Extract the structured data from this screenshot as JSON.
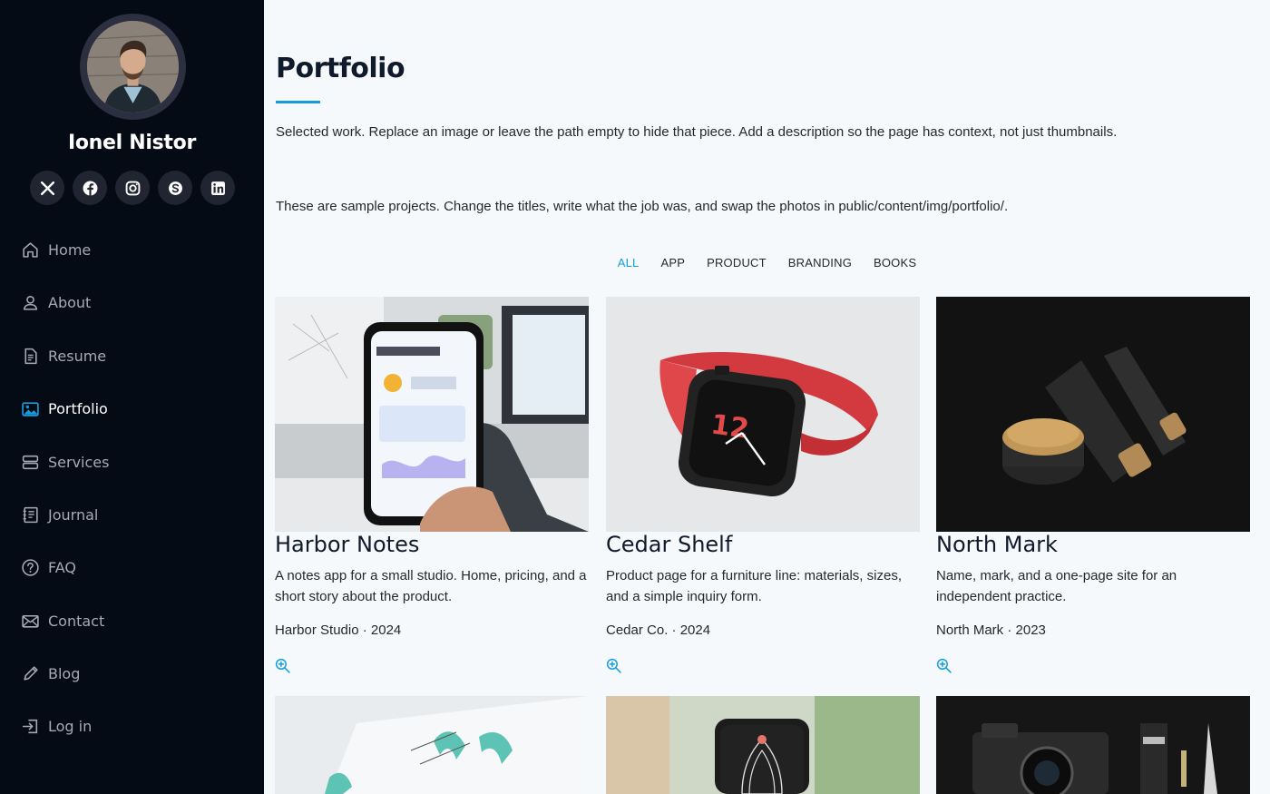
{
  "profile": {
    "name": "Ionel Nistor"
  },
  "social": [
    {
      "icon": "x-twitter-icon",
      "label": "X"
    },
    {
      "icon": "facebook-icon",
      "label": "Facebook"
    },
    {
      "icon": "instagram-icon",
      "label": "Instagram"
    },
    {
      "icon": "skype-icon",
      "label": "Skype"
    },
    {
      "icon": "linkedin-icon",
      "label": "LinkedIn"
    }
  ],
  "nav": [
    {
      "label": "Home",
      "icon": "house-icon"
    },
    {
      "label": "About",
      "icon": "person-icon"
    },
    {
      "label": "Resume",
      "icon": "file-text-icon"
    },
    {
      "label": "Portfolio",
      "icon": "images-icon",
      "active": true
    },
    {
      "label": "Services",
      "icon": "server-icon"
    },
    {
      "label": "Journal",
      "icon": "journal-icon"
    },
    {
      "label": "FAQ",
      "icon": "question-circle-icon"
    },
    {
      "label": "Contact",
      "icon": "envelope-icon"
    },
    {
      "label": "Blog",
      "icon": "pencil-icon"
    },
    {
      "label": "Log in",
      "icon": "box-arrow-in-icon"
    }
  ],
  "portfolio": {
    "title": "Portfolio",
    "intro": "Selected work. Replace an image or leave the path empty to hide that piece. Add a description so the page has context, not just thumbnails.",
    "intro2": "These are sample projects. Change the titles, write what the job was, and swap the photos in public/content/img/portfolio/.",
    "filters": [
      "ALL",
      "APP",
      "PRODUCT",
      "BRANDING",
      "BOOKS"
    ],
    "active_filter": "ALL",
    "items": [
      {
        "title": "Harbor Notes",
        "description": "A notes app for a small studio. Home, pricing, and a short story about the product.",
        "meta": "Harbor Studio · 2024"
      },
      {
        "title": "Cedar Shelf",
        "description": "Product page for a furniture line: materials, sizes, and a simple inquiry form.",
        "meta": "Cedar Co. · 2024"
      },
      {
        "title": "North Mark",
        "description": "Name, mark, and a one-page site for an independent practice.",
        "meta": "North Mark · 2023"
      }
    ]
  },
  "colors": {
    "accent": "#149ddd",
    "sidebar_bg": "#040b14",
    "page_bg": "#f5f9fc"
  }
}
